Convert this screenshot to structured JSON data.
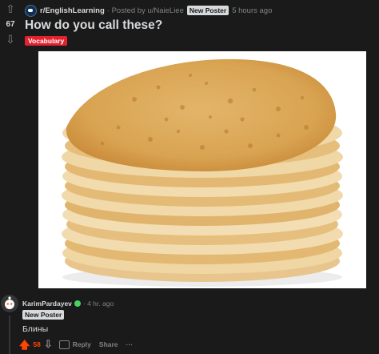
{
  "post": {
    "subreddit": "r/EnglishLearning",
    "posted_by": "· Posted by u/NaieLiee",
    "user_badge": "New Poster",
    "time": "5 hours ago",
    "score": "67",
    "title": "How do you call these?",
    "flair": "Vocabulary",
    "flair_color": "#e2232f"
  },
  "comment": {
    "author": "KarimPardayev",
    "time": "· 4 hr. ago",
    "badge": "New Poster",
    "body": "Блины",
    "score": "58",
    "reply_label": "Reply",
    "share_label": "Share",
    "more_label": "···",
    "upvote_color": "#ff4500"
  },
  "icons": {
    "upvote": "arrow-up-icon",
    "downvote": "arrow-down-icon",
    "comment": "comment-bubble-icon",
    "more": "ellipsis-icon"
  }
}
